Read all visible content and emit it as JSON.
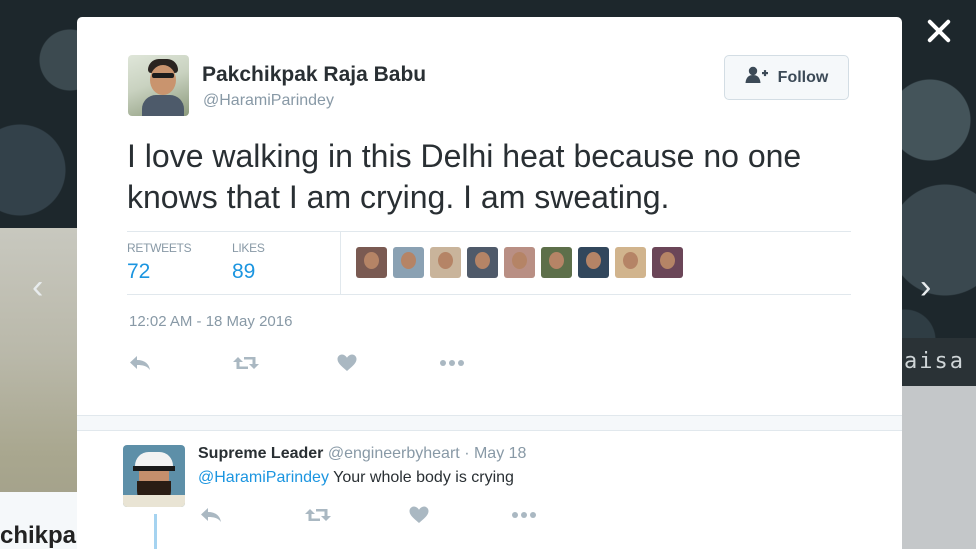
{
  "background": {
    "left_text": "chikpa",
    "right_sign_text": "aisa"
  },
  "modal": {
    "author": {
      "name": "Pakchikpak Raja Babu",
      "handle": "@HaramiParindey"
    },
    "follow_label": "Follow",
    "tweet_text": "I love walking in this Delhi heat because no one knows that I am crying. I am sweating.",
    "stats": {
      "retweets_label": "RETWEETS",
      "retweets": "72",
      "likes_label": "LIKES",
      "likes": "89"
    },
    "likers": [
      {
        "icon": "liker-avatar",
        "color": "#7a5a52"
      },
      {
        "icon": "liker-avatar",
        "color": "#8aa1b3"
      },
      {
        "icon": "liker-avatar",
        "color": "#c9b49b"
      },
      {
        "icon": "liker-avatar",
        "color": "#4f5a6a"
      },
      {
        "icon": "liker-avatar",
        "color": "#b98f84"
      },
      {
        "icon": "liker-avatar",
        "color": "#5d6f4a"
      },
      {
        "icon": "liker-avatar",
        "color": "#32475c"
      },
      {
        "icon": "liker-avatar",
        "color": "#d1b48d"
      },
      {
        "icon": "liker-avatar",
        "color": "#6b4658"
      }
    ],
    "timestamp": "12:02 AM - 18 May 2016",
    "actions": [
      "reply-icon",
      "retweet-icon",
      "like-icon",
      "more-icon"
    ]
  },
  "reply": {
    "name": "Supreme Leader",
    "handle": "@engineerbyheart",
    "separator": "·",
    "date": "May 18",
    "mention": "@HaramiParindey",
    "text": " Your whole body is crying",
    "actions": [
      "reply-icon",
      "retweet-icon",
      "like-icon",
      "more-icon"
    ]
  },
  "colors": {
    "link_blue": "#1b95e0",
    "muted_grey": "#8899a6",
    "text_dark": "#292f33"
  }
}
